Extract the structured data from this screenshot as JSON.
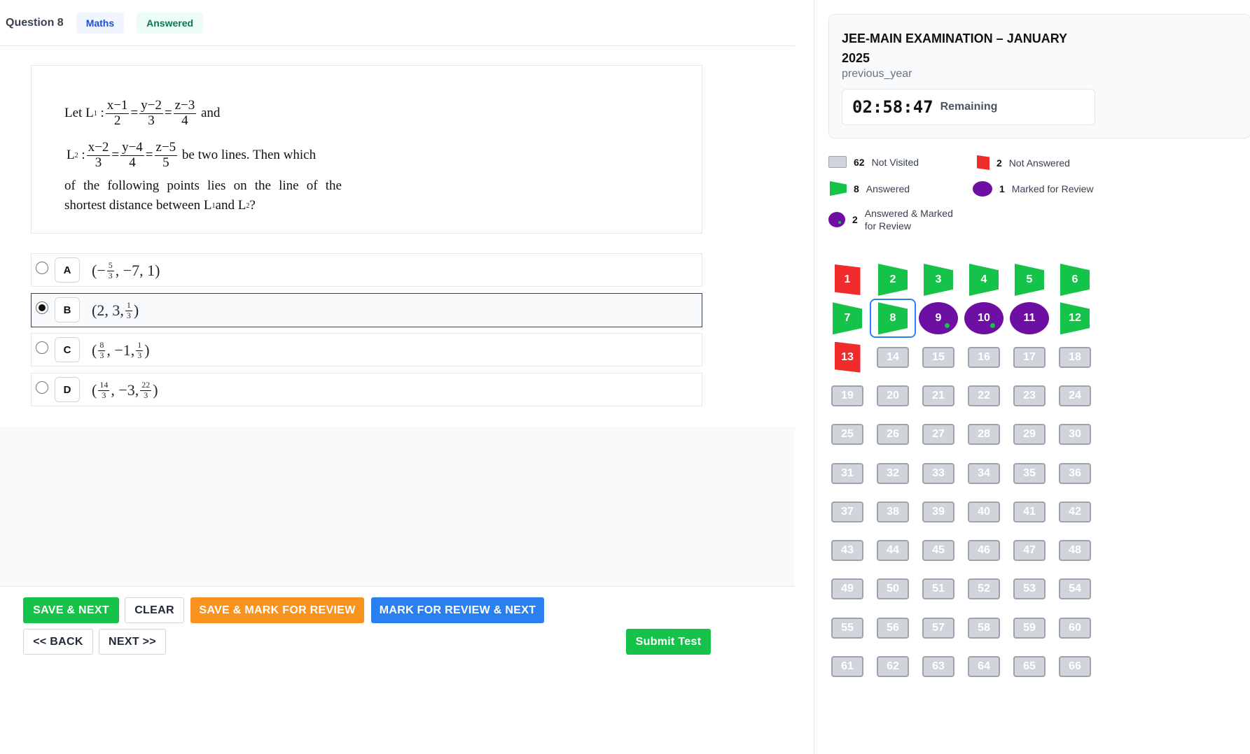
{
  "question": {
    "number_label": "Question 8",
    "subject": "Maths",
    "status": "Answered",
    "text": {
      "let": "Let",
      "L": "L",
      "sub1": "1",
      "sub2": "2",
      "colon": ":",
      "eq": "=",
      "and": "and",
      "l1_fracs": [
        [
          "x−1",
          "2"
        ],
        [
          "y−2",
          "3"
        ],
        [
          "z−3",
          "4"
        ]
      ],
      "l2_fracs": [
        [
          "x−2",
          "3"
        ],
        [
          "y−4",
          "4"
        ],
        [
          "z−5",
          "5"
        ]
      ],
      "tail1": "be two lines. Then which",
      "line3_words": [
        "of",
        "the",
        "following",
        "points",
        "lies",
        "on",
        "the",
        "line",
        "of",
        "the"
      ],
      "line4_pre": "shortest distance between L",
      "line4_mid": " and L",
      "line4_end": " ?"
    }
  },
  "options": [
    {
      "key": "A",
      "parts": [
        "(−",
        [
          "5",
          "3"
        ],
        ", −7, 1)"
      ],
      "selected": false
    },
    {
      "key": "B",
      "parts": [
        "(2, 3, ",
        [
          "1",
          "3"
        ],
        ")"
      ],
      "selected": true
    },
    {
      "key": "C",
      "parts": [
        "(",
        [
          "8",
          "3"
        ],
        ", −1, ",
        [
          "1",
          "3"
        ],
        ")"
      ],
      "selected": false
    },
    {
      "key": "D",
      "parts": [
        "(",
        [
          "14",
          "3"
        ],
        ", −3, ",
        [
          "22",
          "3"
        ],
        ")"
      ],
      "selected": false
    }
  ],
  "actions": {
    "save_next": "SAVE & NEXT",
    "clear": "CLEAR",
    "save_mark_review": "SAVE & MARK FOR REVIEW",
    "mark_review_next": "MARK FOR REVIEW & NEXT",
    "back": "<< BACK",
    "next": "NEXT >>",
    "submit": "Submit Test"
  },
  "exam": {
    "title": "JEE-MAIN EXAMINATION – JANUARY 2025",
    "type": "previous_year",
    "timer": "02:58:47",
    "timer_label": "Remaining"
  },
  "legend": {
    "not_visited": {
      "count": "62",
      "label": "Not Visited"
    },
    "not_answered": {
      "count": "2",
      "label": "Not Answered"
    },
    "answered": {
      "count": "8",
      "label": "Answered"
    },
    "marked_review": {
      "count": "1",
      "label": "Marked for Review"
    },
    "answered_marked": {
      "count": "2",
      "label_line1": "Answered & Marked",
      "label_line2": "for Review"
    }
  },
  "palette": {
    "current": 8,
    "status": {
      "1": "na",
      "2": "an",
      "3": "an",
      "4": "an",
      "5": "an",
      "6": "an",
      "7": "an",
      "8": "an",
      "9": "amr",
      "10": "amr",
      "11": "mr",
      "12": "an",
      "13": "na"
    },
    "total_visible": 66
  },
  "colors": {
    "green": "#16c34a",
    "red": "#ef2b2b",
    "purple": "#6d0fa3",
    "orange": "#f7931e",
    "blue": "#2b80f0",
    "grey": "#d1d5db"
  }
}
